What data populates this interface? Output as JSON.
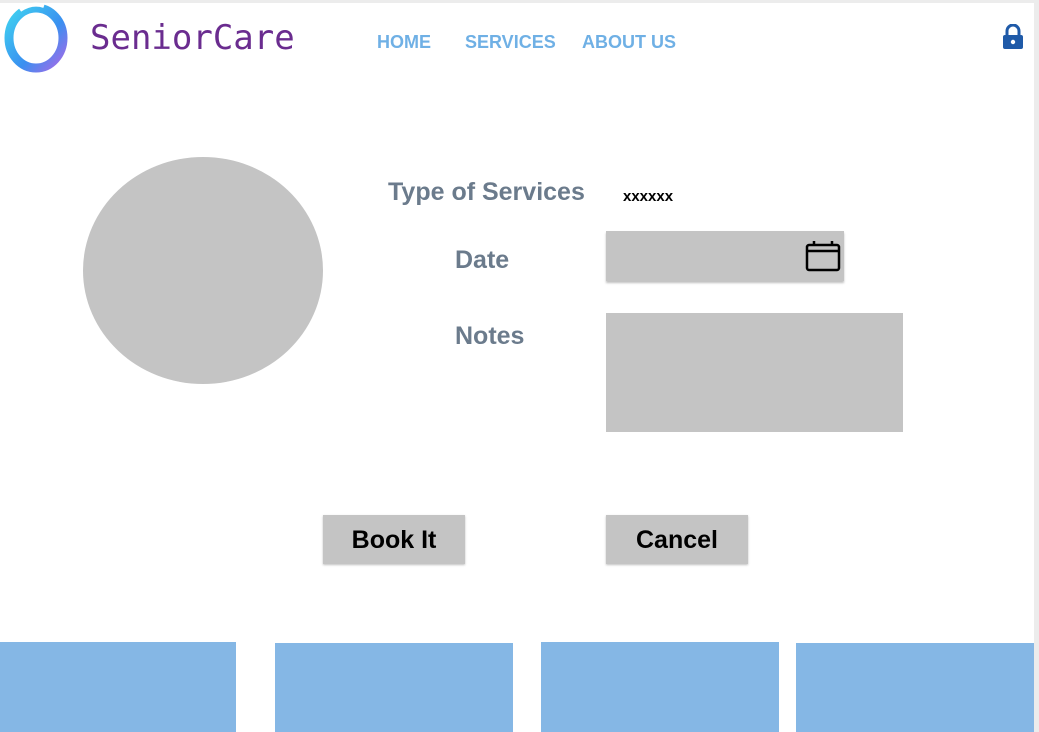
{
  "header": {
    "logo_text": "SeniorCare",
    "nav": [
      {
        "label": "HOME"
      },
      {
        "label": "SERVICES"
      },
      {
        "label": "ABOUT US"
      }
    ],
    "lock_icon": "lock-icon"
  },
  "form": {
    "type_label": "Type of Services",
    "type_value": "xxxxxx",
    "date_label": "Date",
    "date_value": "",
    "notes_label": "Notes",
    "notes_value": "",
    "calendar_icon": "calendar-icon"
  },
  "actions": {
    "book_label": "Book It",
    "cancel_label": "Cancel"
  },
  "footer_tiles": 4,
  "colors": {
    "nav_text": "#6fb0e5",
    "logo_text": "#6a2c8f",
    "label_text": "#6b7b8c",
    "placeholder_gray": "#c4c4c4",
    "tile_blue": "#85b7e5",
    "lock_blue": "#1f5aa8"
  }
}
